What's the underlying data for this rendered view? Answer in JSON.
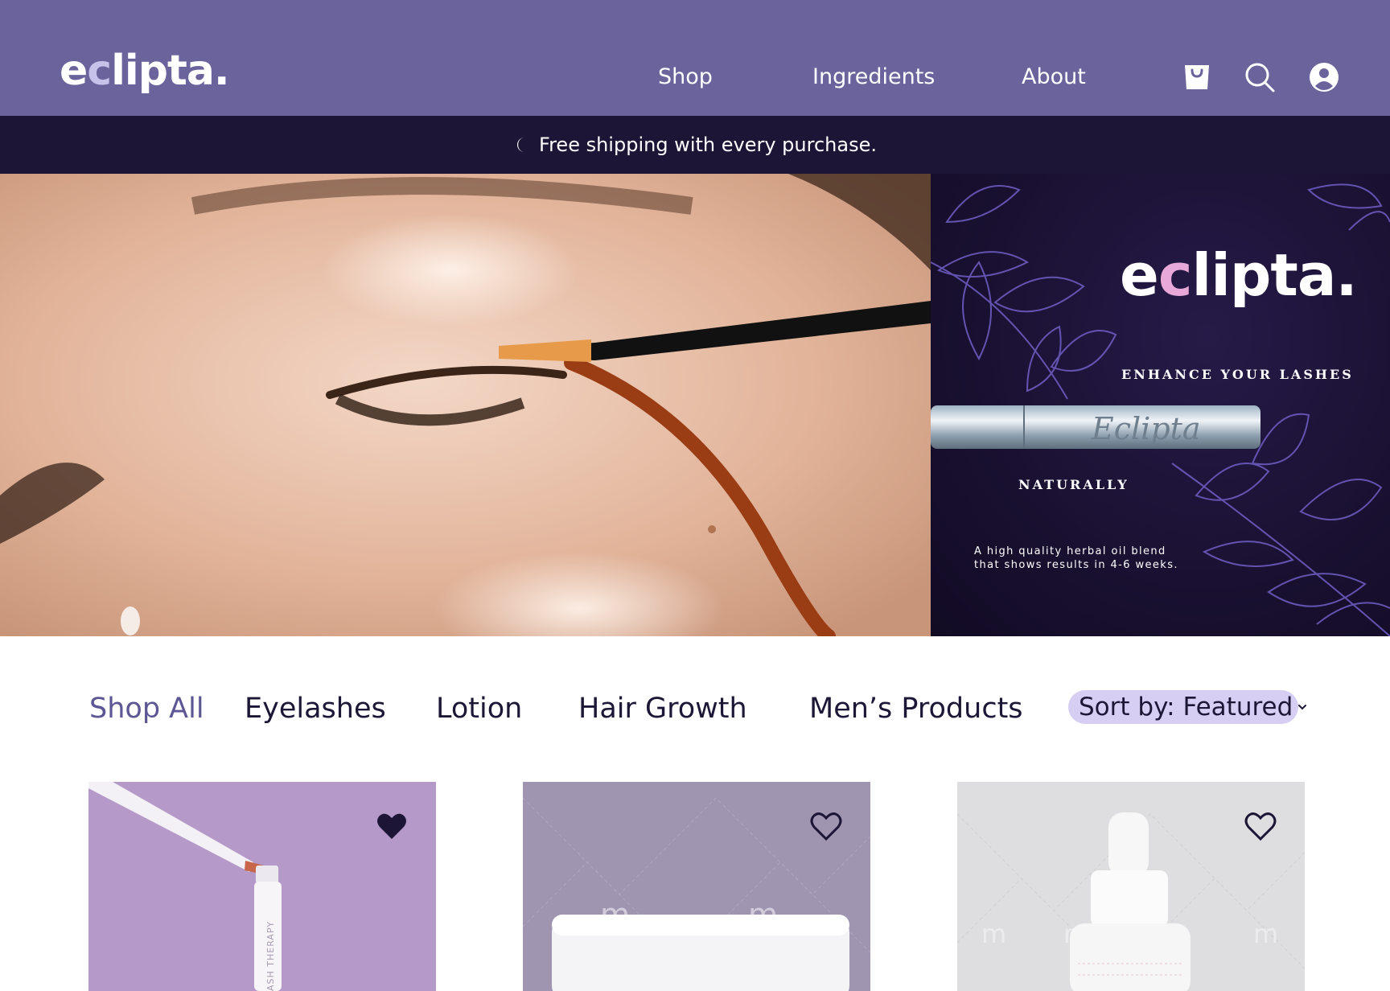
{
  "header": {
    "logo_pre": "e",
    "logo_c": "c",
    "logo_post": "lipta.",
    "nav": {
      "shop": "Shop",
      "ingredients": "Ingredients",
      "about": "About"
    },
    "icons": [
      "shopping-bag-icon",
      "search-icon",
      "account-icon"
    ]
  },
  "announcement": {
    "icon": "moon-icon",
    "text": "Free shipping with every purchase."
  },
  "hero": {
    "banner": {
      "logo_pre": "e",
      "logo_c": "c",
      "logo_post": "lipta.",
      "tagline": "ENHANCE YOUR LASHES",
      "naturally": "NATURALLY",
      "tube_label": "Eclipta",
      "description_line1": "A high quality herbal oil blend",
      "description_line2": "that shows results in 4-6 weeks."
    }
  },
  "filters": {
    "shop_all": "Shop All",
    "eyelashes": "Eyelashes",
    "lotion": "Lotion",
    "hair_growth": "Hair Growth",
    "mens_products": "Men’s Products",
    "sort_label": "Sort by: Featured"
  },
  "products": [
    {
      "favorited": true,
      "bottle_label": "ASH THERAPY"
    },
    {
      "favorited": false,
      "watermark": "m"
    },
    {
      "favorited": false,
      "watermark": "m"
    }
  ],
  "colors": {
    "header_bg": "#6b639c",
    "announce_bg": "#1d1536",
    "sort_bg": "#d6cff3",
    "active_filter": "#5d5694",
    "text_dark": "#1c1736"
  }
}
